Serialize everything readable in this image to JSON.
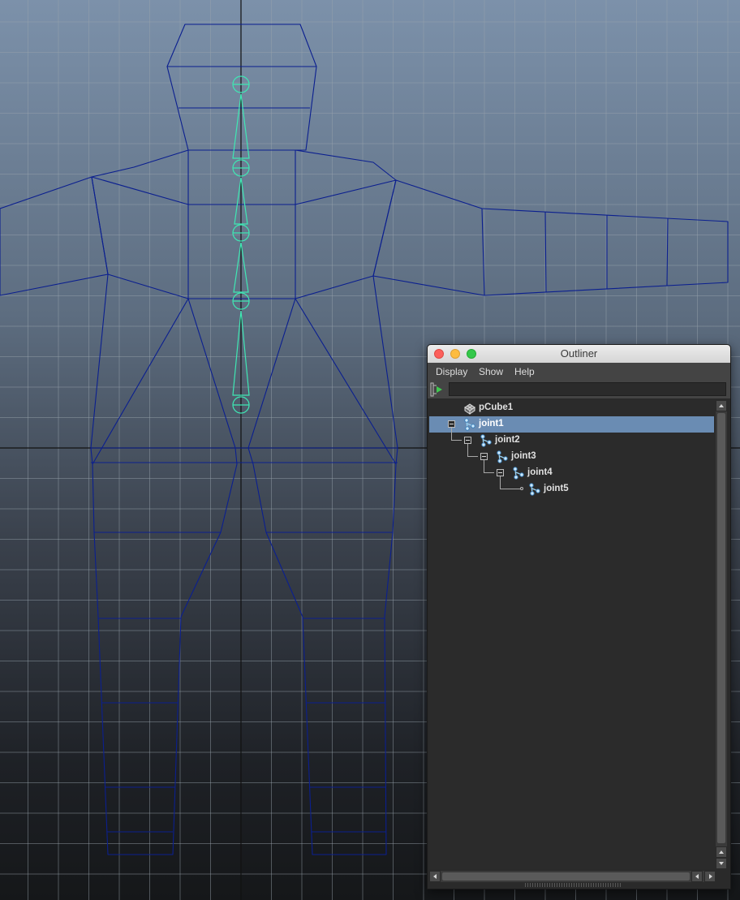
{
  "window": {
    "title": "Outliner",
    "controls": [
      "close-icon",
      "minimize-icon",
      "zoom-icon"
    ]
  },
  "menu": {
    "display": "Display",
    "show": "Show",
    "help": "Help"
  },
  "filter": {
    "icon": "filter-play-icon",
    "value": ""
  },
  "tree": {
    "items": [
      {
        "label": "pCube1",
        "icon": "mesh-icon",
        "depth": 0,
        "expandable": false,
        "selected": false
      },
      {
        "label": "joint1",
        "icon": "joint-icon",
        "depth": 0,
        "expandable": true,
        "selected": true
      },
      {
        "label": "joint2",
        "icon": "joint-icon",
        "depth": 1,
        "expandable": true,
        "selected": false
      },
      {
        "label": "joint3",
        "icon": "joint-icon",
        "depth": 2,
        "expandable": true,
        "selected": false
      },
      {
        "label": "joint4",
        "icon": "joint-icon",
        "depth": 3,
        "expandable": true,
        "selected": false
      },
      {
        "label": "joint5",
        "icon": "joint-icon",
        "depth": 4,
        "expandable": false,
        "selected": false
      }
    ]
  },
  "colors": {
    "selection": "#6a8cb3",
    "mesh_wire": "#0b1f8f",
    "joint": "#3fe8b4",
    "panel_bg": "#2b2b2b"
  }
}
